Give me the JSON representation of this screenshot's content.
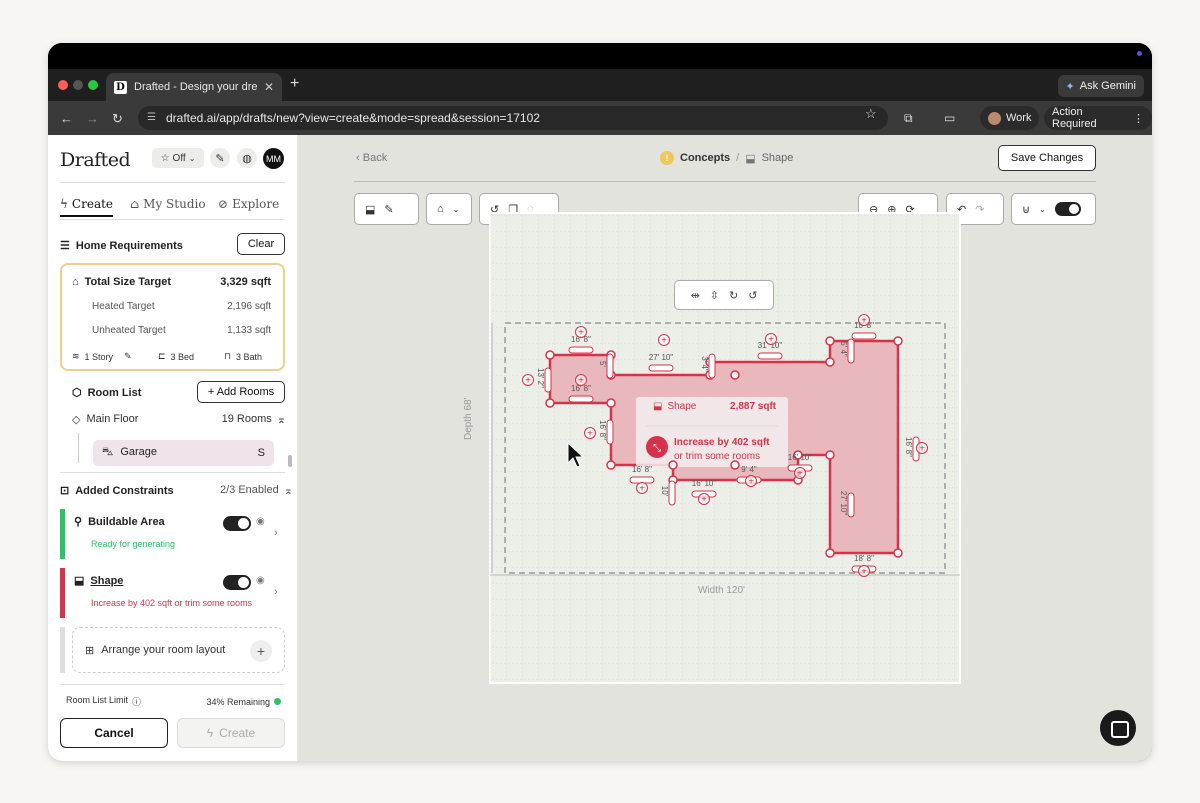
{
  "browser": {
    "tab_title": "Drafted - Design your dream h",
    "favicon_letter": "D",
    "url": "drafted.ai/app/drafts/new?view=create&mode=spread&session=17102",
    "ask_gemini": "Ask Gemini",
    "profile": "Work",
    "action_required": "Action Required"
  },
  "sidebar": {
    "logo": "Drafted",
    "off_label": "Off",
    "avatar": "MM",
    "tabs": [
      {
        "label": "Create"
      },
      {
        "label": "My Studio"
      },
      {
        "label": "Explore"
      }
    ],
    "home_requirements": "Home Requirements",
    "clear": "Clear",
    "total_size": {
      "label": "Total Size Target",
      "value": "3,329 sqft"
    },
    "heated": {
      "label": "Heated Target",
      "value": "2,196 sqft"
    },
    "unheated": {
      "label": "Unheated Target",
      "value": "1,133 sqft"
    },
    "meta": {
      "story": "1 Story",
      "bed": "3 Bed",
      "bath": "3 Bath"
    },
    "room_list": "Room List",
    "add_rooms": "+ Add Rooms",
    "main_floor": "Main Floor",
    "main_floor_count": "19 Rooms",
    "garage": {
      "label": "Garage",
      "size": "S"
    },
    "added_constraints": "Added Constraints",
    "enabled": "2/3 Enabled",
    "buildable": {
      "title": "Buildable Area",
      "status": "Ready for generating"
    },
    "shape": {
      "title": "Shape",
      "status": "Increase by 402 sqft or trim some rooms"
    },
    "arrange": "Arrange your room layout",
    "limit_label": "Room List Limit",
    "limit_value": "34% Remaining",
    "cancel": "Cancel",
    "create": "Create"
  },
  "canvas": {
    "back": "Back",
    "concepts": "Concepts",
    "sep": "/",
    "shape": "Shape",
    "save": "Save Changes",
    "depth": "Depth  68'",
    "width": "Width  120'",
    "popup_title": "Shape",
    "popup_area": "2,887 sqft",
    "popup_line1": "Increase by 402 sqft",
    "popup_line2": "or trim some rooms",
    "dims": [
      "16' 8\"",
      "16' 8\"",
      "13' 2\"",
      "5'",
      "27' 10\"",
      "3' 4\"",
      "31' 10\"",
      "5' 4\"",
      "18' 8\"",
      "16' 8\"",
      "10'",
      "16' 10\"",
      "9' 4\"",
      "16' 10\"",
      "27' 10\"",
      "18' 8\"",
      "16' 8\"",
      "16' 8\""
    ],
    "accent": "#d6334a"
  }
}
